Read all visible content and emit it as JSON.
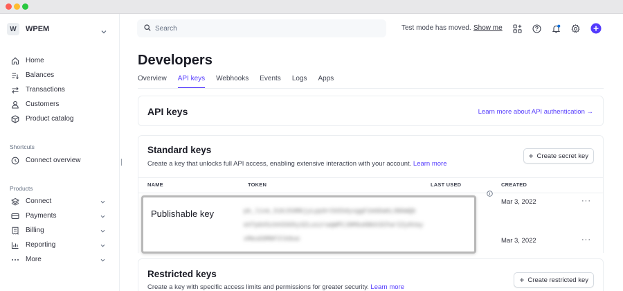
{
  "window": {},
  "sidebar": {
    "account": {
      "badge": "W",
      "name": "WPEM"
    },
    "main_nav": [
      {
        "label": "Home",
        "icon": "home-icon"
      },
      {
        "label": "Balances",
        "icon": "balances-icon"
      },
      {
        "label": "Transactions",
        "icon": "transactions-icon"
      },
      {
        "label": "Customers",
        "icon": "customers-icon"
      },
      {
        "label": "Product catalog",
        "icon": "product-catalog-icon"
      }
    ],
    "shortcuts_label": "Shortcuts",
    "shortcuts": [
      {
        "label": "Connect overview",
        "icon": "connect-overview-icon"
      }
    ],
    "products_label": "Products",
    "products": [
      {
        "label": "Connect",
        "icon": "connect-icon",
        "expandable": true
      },
      {
        "label": "Payments",
        "icon": "payments-icon",
        "expandable": true
      },
      {
        "label": "Billing",
        "icon": "billing-icon",
        "expandable": true
      },
      {
        "label": "Reporting",
        "icon": "reporting-icon",
        "expandable": true
      },
      {
        "label": "More",
        "icon": "more-dots-icon",
        "expandable": true
      }
    ]
  },
  "topbar": {
    "search_placeholder": "Search",
    "test_mode_text": "Test mode has moved.",
    "show_me": "Show me",
    "icons": [
      "apps-grid-icon",
      "help-icon",
      "notifications-bell-icon",
      "settings-gear-icon",
      "create-plus-icon"
    ],
    "accent": "#533afd"
  },
  "page": {
    "title": "Developers",
    "tabs": [
      {
        "label": "Overview",
        "active": false
      },
      {
        "label": "API keys",
        "active": true
      },
      {
        "label": "Webhooks",
        "active": false
      },
      {
        "label": "Events",
        "active": false
      },
      {
        "label": "Logs",
        "active": false
      },
      {
        "label": "Apps",
        "active": false
      }
    ]
  },
  "api_keys_card": {
    "title": "API keys",
    "learn_more": "Learn more about API authentication →"
  },
  "standard_keys": {
    "title": "Standard keys",
    "description": "Create a key that unlocks full API access, enabling extensive interaction with your account.",
    "learn_more": "Learn more",
    "create_button": "Create secret key",
    "columns": [
      "NAME",
      "TOKEN",
      "LAST USED",
      "CREATED"
    ],
    "rows": [
      {
        "name": "Publishable key",
        "created": "Mar 3, 2022"
      },
      {
        "name": "",
        "created": "Mar 3, 2022"
      }
    ]
  },
  "highlight": {
    "label": "Publishable key",
    "token_lines": [
      "pk_live_51KJS9RKjyLpp9rCb55dysggF2ebDaKL3NbWQb",
      "eXTpbX5zkH3SO5y3ZLuszrwqWPCJ8M9uKB6X3CFwrIZy6Vay",
      "xMeuG9M0F3lk8uo"
    ]
  },
  "restricted_keys": {
    "title": "Restricted keys",
    "description": "Create a key with specific access limits and permissions for greater security.",
    "learn_more": "Learn more",
    "create_button": "Create restricted key"
  }
}
